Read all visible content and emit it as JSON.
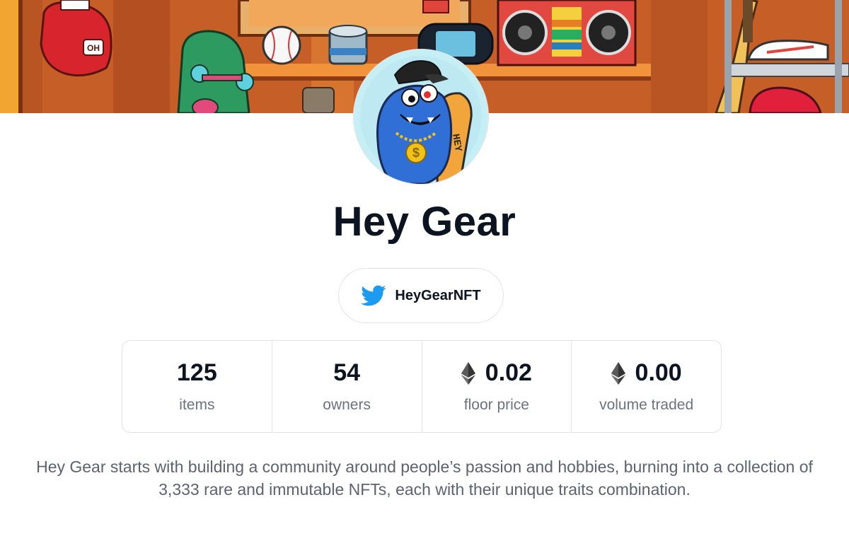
{
  "collection": {
    "name": "Hey Gear",
    "description": "Hey Gear starts with building a community around people’s passion and hobbies, burning into a collection of 3,333 rare and immutable NFTs, each with their unique traits combination."
  },
  "banner": {
    "boxing_glove_text": "OH"
  },
  "social": {
    "icon": "twitter-icon",
    "handle": "HeyGearNFT"
  },
  "stats": [
    {
      "value": "125",
      "label": "items",
      "icon": null
    },
    {
      "value": "54",
      "label": "owners",
      "icon": null
    },
    {
      "value": "0.02",
      "label": "floor price",
      "icon": "ethereum-icon"
    },
    {
      "value": "0.00",
      "label": "volume traded",
      "icon": "ethereum-icon"
    }
  ],
  "colors": {
    "title": "#0d1421",
    "muted": "#6b7280",
    "twitter": "#1d9bf0",
    "border": "#e1e4e8",
    "banner_wall": "#c9652a"
  }
}
